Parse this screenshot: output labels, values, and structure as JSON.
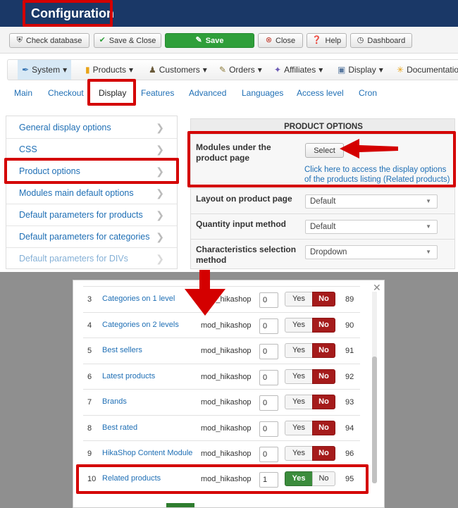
{
  "header": {
    "title": "Configuration"
  },
  "toolbar": {
    "check_database": "Check database",
    "save_close": "Save & Close",
    "save": "Save",
    "close": "Close",
    "help": "Help",
    "dashboard": "Dashboard"
  },
  "menu": [
    "System",
    "Products",
    "Customers",
    "Orders",
    "Affiliates",
    "Display",
    "Documentation"
  ],
  "tabs": [
    "Main",
    "Checkout",
    "Display",
    "Features",
    "Advanced",
    "Languages",
    "Access level",
    "Cron"
  ],
  "left_list": [
    "General display options",
    "CSS",
    "Product options",
    "Modules main default options",
    "Default parameters for products",
    "Default parameters for categories",
    "Default parameters for DIVs"
  ],
  "product_options": {
    "heading": "PRODUCT OPTIONS",
    "modules_label": "Modules under the product page",
    "select_button": "Select",
    "help_text": "Click here to access the display options of the products listing (Related products)",
    "layout_label": "Layout on product page",
    "layout_value": "Default",
    "quantity_label": "Quantity input method",
    "quantity_value": "Default",
    "characteristics_label": "Characteristics selection method",
    "characteristics_value": "Dropdown"
  },
  "modules": [
    {
      "num": "3",
      "name": "Categories on 1 level",
      "type": "mod_hikashop",
      "ordering": "0",
      "enabled": false,
      "id": "89"
    },
    {
      "num": "4",
      "name": "Categories on 2 levels",
      "type": "mod_hikashop",
      "ordering": "0",
      "enabled": false,
      "id": "90"
    },
    {
      "num": "5",
      "name": "Best sellers",
      "type": "mod_hikashop",
      "ordering": "0",
      "enabled": false,
      "id": "91"
    },
    {
      "num": "6",
      "name": "Latest products",
      "type": "mod_hikashop",
      "ordering": "0",
      "enabled": false,
      "id": "92"
    },
    {
      "num": "7",
      "name": "Brands",
      "type": "mod_hikashop",
      "ordering": "0",
      "enabled": false,
      "id": "93"
    },
    {
      "num": "8",
      "name": "Best rated",
      "type": "mod_hikashop",
      "ordering": "0",
      "enabled": false,
      "id": "94"
    },
    {
      "num": "9",
      "name": "HikaShop Content Module",
      "type": "mod_hikashop",
      "ordering": "0",
      "enabled": false,
      "id": "96"
    },
    {
      "num": "10",
      "name": "Related products",
      "type": "mod_hikashop",
      "ordering": "1",
      "enabled": true,
      "id": "95"
    }
  ],
  "toggle": {
    "yes": "Yes",
    "no": "No"
  },
  "colors": {
    "highlight": "#d40000",
    "header": "#1a3867",
    "link": "#1f6fb5",
    "yes_on": "#3b8c3c",
    "no_on": "#a51b1b"
  }
}
